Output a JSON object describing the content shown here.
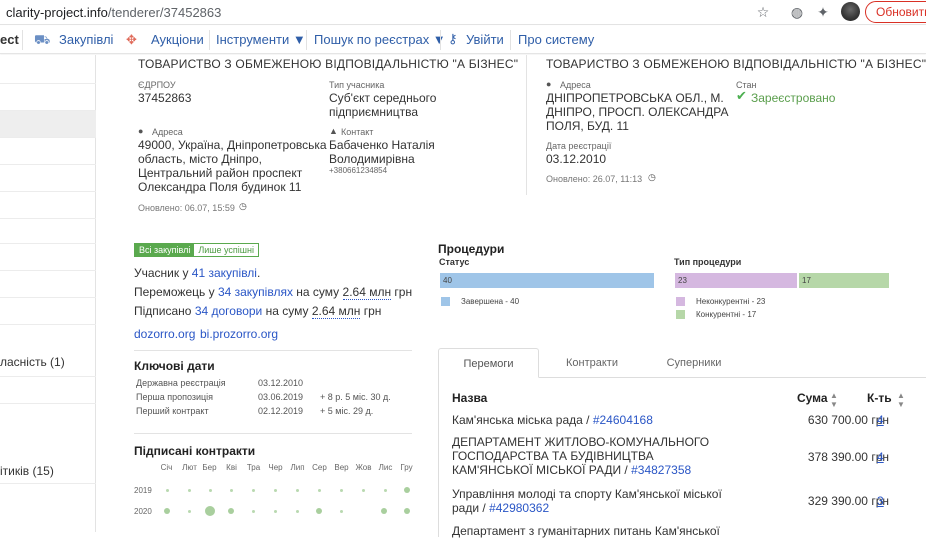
{
  "browser": {
    "url_host": "clarity-project.info",
    "url_path": "/tenderer/37452863",
    "update_label": "Обновить"
  },
  "nav": {
    "brand_fragment": "ect",
    "items": [
      {
        "label": "Закупівлі"
      },
      {
        "label": "Аукціони"
      },
      {
        "label": "Інструменти ▼"
      },
      {
        "label": "Пошук по реєстрах ▼"
      },
      {
        "label": "Увійти"
      },
      {
        "label": "Про систему"
      }
    ]
  },
  "sidebar": {
    "items": [
      {
        "label": ""
      },
      {
        "label": ""
      },
      {
        "label": ""
      },
      {
        "label": ""
      },
      {
        "label": ""
      },
      {
        "label": ""
      },
      {
        "label": ""
      },
      {
        "label": ""
      },
      {
        "label": ""
      },
      {
        "label": ""
      },
      {
        "label": "ласність (1)"
      },
      {
        "label": ""
      },
      {
        "label": "ітиків (15)"
      },
      {
        "label": ""
      }
    ]
  },
  "left_card": {
    "title": "ТОВАРИСТВО З ОБМЕЖЕНОЮ ВІДПОВІДАЛЬНІСТЮ \"А БІЗНЕС\"",
    "edrpou_label": "ЄДРПОУ",
    "edrpou": "37452863",
    "type_label": "Тип учасника",
    "type_value_1": "Суб'єкт середнього",
    "type_value_2": "підприємництва",
    "address_label": "Адреса",
    "address_1": "49000, Україна, Дніпропетровська",
    "address_2": "область, місто Дніпро,",
    "address_3": "Центральний район проспект",
    "address_4": "Олександра Поля будинок 11",
    "contact_label": "Контакт",
    "contact_name_1": "Бабаченко Наталія",
    "contact_name_2": "Володимирівна",
    "contact_phone": "+380661234854",
    "updated": "Оновлено: 06.07, 15:59"
  },
  "right_card": {
    "title": "ТОВАРИСТВО З ОБМЕЖЕНОЮ ВІДПОВІДАЛЬНІСТЮ \"А БІЗНЕС\"",
    "address_label": "Адреса",
    "address_1": "ДНІПРОПЕТРОВСЬКА ОБЛ., М.",
    "address_2": "ДНІПРО, ПРОСП. ОЛЕКСАНДРА",
    "address_3": "ПОЛЯ, БУД. 11",
    "status_label": "Стан",
    "status_value": "Зареєстровано",
    "regdate_label": "Дата реєстрації",
    "regdate": "03.12.2010",
    "updated": "Оновлено: 26.07, 11:13"
  },
  "toggle": {
    "on": "Всі закупівлі",
    "off": "Лише успішні"
  },
  "stats": {
    "l1_pre": "Учасник у ",
    "l1_link": "41 закупівлі",
    "l1_post": ".",
    "l2_pre": "Переможець у ",
    "l2_link": "34 закупівлях",
    "l2_mid": " на суму ",
    "l2_sum": "2.64 млн",
    "l2_post": " грн",
    "l3_pre": "Підписано ",
    "l3_link": "34 договори",
    "l3_mid": " на суму ",
    "l3_sum": "2.64 млн",
    "l3_post": " грн",
    "link_a": "dozorro.org",
    "link_b": "bi.prozorro.org"
  },
  "key_dates": {
    "title": "Ключові дати",
    "rows": [
      {
        "label": "Державна реєстрація",
        "date": "03.12.2010",
        "delta": ""
      },
      {
        "label": "Перша пропозиція",
        "date": "03.06.2019",
        "delta": "+ 8 р. 5 міс. 30 д."
      },
      {
        "label": "Перший контракт",
        "date": "02.12.2019",
        "delta": "+ 5 міс. 29 д."
      }
    ]
  },
  "contracts": {
    "title": "Підписані контракти",
    "months": [
      "Січ",
      "Лют",
      "Бер",
      "Кві",
      "Тра",
      "Чер",
      "Лип",
      "Сер",
      "Вер",
      "Жов",
      "Лис",
      "Гру"
    ],
    "years": [
      "2019",
      "2020"
    ]
  },
  "procedures": {
    "title": "Процедури",
    "status_title": "Статус",
    "type_title": "Тип процедури",
    "status_bar_value": "40",
    "status_legend": "Завершена - 40",
    "type_bar_a": "23",
    "type_bar_b": "17",
    "type_legend_a": "Неконкурентні - 23",
    "type_legend_b": "Конкурентні - 17",
    "colors": {
      "status": "#9fc5e8",
      "noncompetitive": "#d5b8e0",
      "competitive": "#b6d7a8"
    }
  },
  "tabs": {
    "wins": "Перемоги",
    "contracts": "Контракти",
    "rivals": "Суперники"
  },
  "table": {
    "col_name": "Назва",
    "col_sum": "Сума",
    "col_count": "К-ть",
    "rows": [
      {
        "name": "Кам'янська міська рада / ",
        "code": "#24604168",
        "sum": "630 700.00 грн",
        "count": "4"
      },
      {
        "name": "ДЕПАРТАМЕНТ ЖИТЛОВО-КОМУНАЛЬНОГО ГОСПОДАРСТВА ТА БУДІВНИЦТВА КАМ'ЯНСЬКОЇ МІСЬКОЇ РАДИ / ",
        "code": "#34827358",
        "sum": "378 390.00 грн",
        "count": "4"
      },
      {
        "name": "Управління молоді та спорту Кам'янської міської ради / ",
        "code": "#42980362",
        "sum": "329 390.00 грн",
        "count": "3"
      },
      {
        "name": "Департамент з гуманітарних питань Кам'янської",
        "code": "",
        "sum": "",
        "count": ""
      }
    ]
  }
}
